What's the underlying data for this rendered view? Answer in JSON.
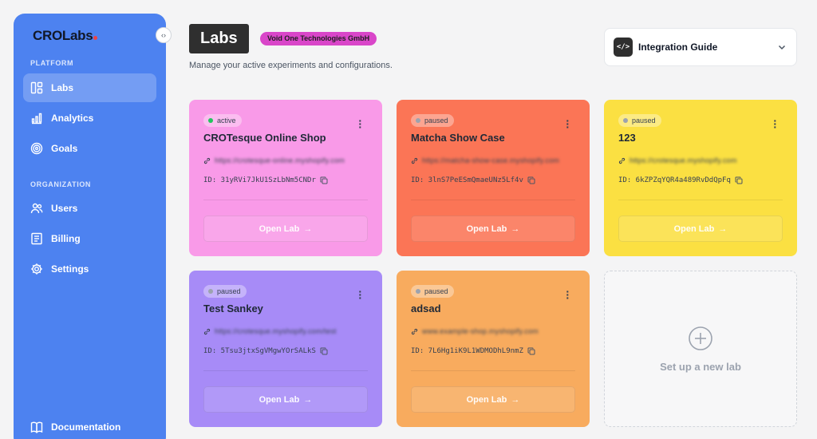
{
  "sidebar": {
    "logo": "CROLabs",
    "sections": [
      "PLATFORM",
      "ORGANIZATION"
    ],
    "platform_items": [
      {
        "label": "Labs",
        "icon": "layout-icon",
        "active": true
      },
      {
        "label": "Analytics",
        "icon": "bar-chart-icon",
        "active": false
      },
      {
        "label": "Goals",
        "icon": "target-icon",
        "active": false
      }
    ],
    "org_items": [
      {
        "label": "Users",
        "icon": "users-icon"
      },
      {
        "label": "Billing",
        "icon": "billing-icon"
      },
      {
        "label": "Settings",
        "icon": "gear-icon"
      }
    ],
    "documentation": "Documentation"
  },
  "header": {
    "title": "Labs",
    "org": "Void One Technologies GmbH",
    "subtitle": "Manage your active experiments and configurations.",
    "guide_label": "Integration Guide"
  },
  "labs": [
    {
      "status": "active",
      "title": "CROTesque Online Shop",
      "url": "https://crotesque-online.myshopify.com",
      "id": "ID: 31yRVi7JkU1SzLbNm5CNDr",
      "button": "Open Lab",
      "color": "#f99ae8",
      "status_dot": "#22c55e"
    },
    {
      "status": "paused",
      "title": "Matcha Show Case",
      "url": "https://matcha-show-case.myshopify.com",
      "id": "ID: 3lnS7PeESmQmaeUNz5Lf4v",
      "button": "Open Lab",
      "color": "#fb7556",
      "status_dot": "#9ca3af"
    },
    {
      "status": "paused",
      "title": "123",
      "url": "https://crotesque.myshopify.com",
      "id": "ID: 6kZPZqYQR4a489RvDdQpFq",
      "button": "Open Lab",
      "color": "#fbe042",
      "status_dot": "#9ca3af"
    },
    {
      "status": "paused",
      "title": "Test Sankey",
      "url": "https://crotesque.myshopify.com/test",
      "id": "ID: 5Tsu3jtxSgVMgwYOrSALkS",
      "button": "Open Lab",
      "color": "#a78bf7",
      "status_dot": "#9ca3af"
    },
    {
      "status": "paused",
      "title": "adsad",
      "url": "www.example-shop.myshopify.com",
      "id": "ID: 7L6Hg1iK9L1WDMODhL9nmZ",
      "button": "Open Lab",
      "color": "#f8ab5e",
      "status_dot": "#9ca3af"
    }
  ],
  "new_lab_label": "Set up a new lab"
}
